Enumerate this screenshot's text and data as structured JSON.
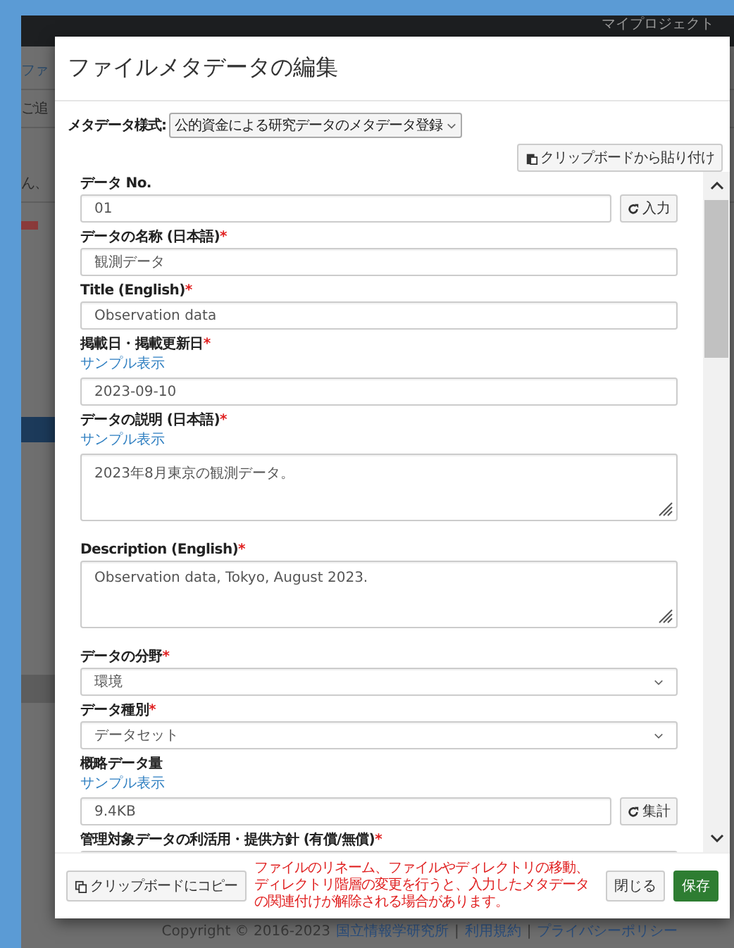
{
  "background": {
    "app_title": "マイプロジェクト",
    "fragments": [
      "ファ",
      "ご追",
      "ん、"
    ],
    "copyright": [
      {
        "kind": "text",
        "text": "Copyright © 2016-2023"
      },
      {
        "kind": "link",
        "text": "国立情報学研究所"
      },
      {
        "kind": "text",
        "text": "|"
      },
      {
        "kind": "link",
        "text": "利用規約"
      },
      {
        "kind": "text",
        "text": "|"
      },
      {
        "kind": "link",
        "text": "プライバシーポリシー"
      }
    ]
  },
  "dialog": {
    "title": "ファイルメタデータの編集",
    "schema": {
      "label": "メタデータ様式:",
      "value": "公的資金による研究データのメタデータ登録"
    },
    "paste_button": "クリップボードから貼り付け",
    "fields": [
      {
        "kind": "text",
        "label": "データ No.",
        "value": "01",
        "action": "入力"
      },
      {
        "kind": "text",
        "label": "データの名称 (日本語)",
        "required_mark": "*",
        "value": "観測データ"
      },
      {
        "kind": "text",
        "label": "Title (English)",
        "required_mark": "*",
        "value": "Observation data"
      },
      {
        "kind": "text",
        "label": "掲載日・掲載更新日",
        "required_mark": "*",
        "sample": "サンプル表示",
        "value": "2023-09-10"
      },
      {
        "kind": "textarea",
        "label": "データの説明 (日本語)",
        "required_mark": "*",
        "sample": "サンプル表示",
        "value": "2023年8月東京の観測データ。"
      },
      {
        "kind": "textarea",
        "label": "Description (English)",
        "required_mark": "*",
        "value": "Observation data, Tokyo, August 2023."
      },
      {
        "kind": "select",
        "label": "データの分野",
        "required_mark": "*",
        "value": "環境"
      },
      {
        "kind": "select",
        "label": "データ種別",
        "required_mark": "*",
        "value": "データセット"
      },
      {
        "kind": "text",
        "label": "概略データ量",
        "sample": "サンプル表示",
        "value": "9.4KB",
        "action": "集計"
      },
      {
        "kind": "text",
        "label": "管理対象データの利活用・提供方針 (有償/無償)",
        "required_mark": "*"
      }
    ],
    "footer": {
      "copy_button": "クリップボードにコピー",
      "warning": "ファイルのリネーム、ファイルやディレクトリの移動、ディレクトリ階層の変更を行うと、入力したメタデータの関連付けが解除される場合があります。",
      "close_button": "閉じる",
      "save_button": "保存"
    }
  }
}
